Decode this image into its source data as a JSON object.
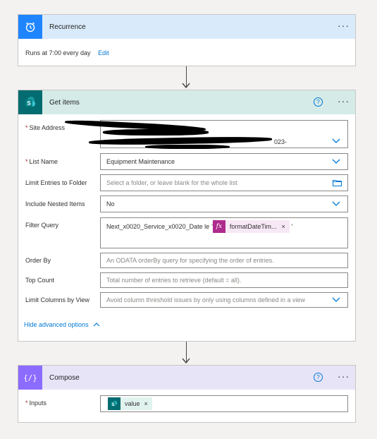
{
  "recurrence": {
    "title": "Recurrence",
    "summary": "Runs at 7:00 every day",
    "edit_label": "Edit",
    "more_label": "···",
    "icon": "alarm-clock-icon"
  },
  "get_items": {
    "title": "Get items",
    "help_label": "?",
    "more_label": "···",
    "icon": "sharepoint-icon",
    "fields": {
      "site_address": {
        "label": "Site Address",
        "value": "023-"
      },
      "list_name": {
        "label": "List Name",
        "value": "Equipment Maintenance"
      },
      "limit_folder": {
        "label": "Limit Entries to Folder",
        "placeholder": "Select a folder, or leave blank for the whole list"
      },
      "nested_items": {
        "label": "Include Nested Items",
        "value": "No"
      },
      "filter_query": {
        "label": "Filter Query",
        "prefix": "Next_x0020_Service_x0020_Date le",
        "quote_open": "'",
        "token_label": "formatDateTim...",
        "token_close": "×",
        "quote_close": "'"
      },
      "order_by": {
        "label": "Order By",
        "placeholder": "An ODATA orderBy query for specifying the order of entries."
      },
      "top_count": {
        "label": "Top Count",
        "placeholder": "Total number of entries to retrieve (default = all)."
      },
      "limit_columns": {
        "label": "Limit Columns by View",
        "placeholder": "Avoid column threshold issues by only using columns defined in a view"
      }
    },
    "advanced_toggle": "Hide advanced options"
  },
  "compose": {
    "title": "Compose",
    "help_label": "?",
    "more_label": "···",
    "icon": "curly-braces-icon",
    "inputs_label": "Inputs",
    "token_label": "value",
    "token_close": "×"
  },
  "colors": {
    "recurrence_header": "#d9ebfb",
    "recurrence_icon_bg": "#1f85ff",
    "get_items_header": "#d5ebe8",
    "sharepoint_bg": "#036c70",
    "compose_header": "#e8e4f8",
    "compose_icon_bg": "#8c6cff",
    "accent": "#0078d4"
  }
}
